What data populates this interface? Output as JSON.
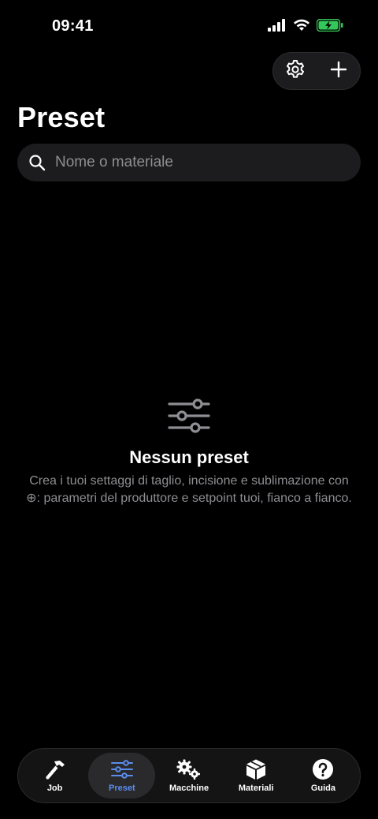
{
  "status_bar": {
    "time": "09:41"
  },
  "header": {
    "title": "Preset",
    "settings_icon": "gear-icon",
    "add_icon": "plus-icon"
  },
  "search": {
    "placeholder": "Nome o materiale",
    "value": ""
  },
  "empty_state": {
    "icon": "sliders-icon",
    "title": "Nessun preset",
    "description": "Crea i tuoi settaggi di taglio, incisione e sublimazione con ⊕: parametri del produttore e setpoint tuoi, fianco a fianco."
  },
  "tab_bar": {
    "tabs": [
      {
        "label": "Job",
        "icon": "hammer-icon",
        "active": false
      },
      {
        "label": "Preset",
        "icon": "sliders-icon",
        "active": true
      },
      {
        "label": "Macchine",
        "icon": "gears-icon",
        "active": false
      },
      {
        "label": "Materiali",
        "icon": "box-icon",
        "active": false
      },
      {
        "label": "Guida",
        "icon": "help-icon",
        "active": false
      }
    ]
  },
  "colors": {
    "background": "#000000",
    "accent": "#5b8def",
    "battery": "#34c759",
    "secondary_text": "#8e8e93"
  }
}
